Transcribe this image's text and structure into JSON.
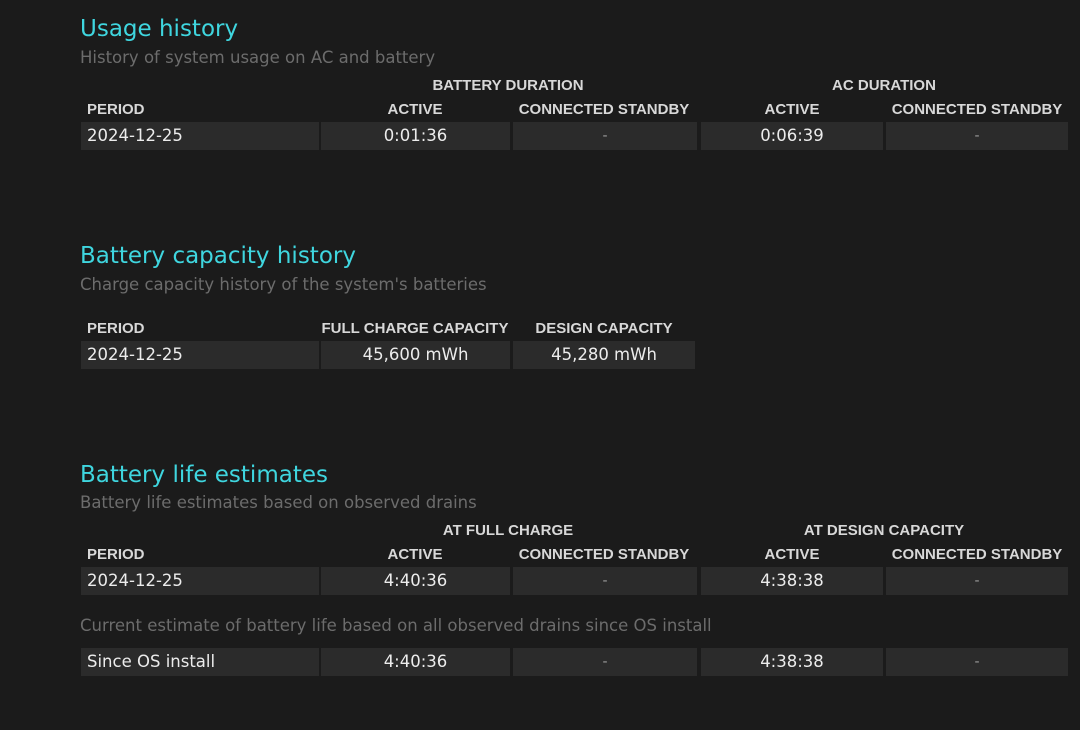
{
  "usage": {
    "title": "Usage history",
    "subtitle": "History of system usage on AC and battery",
    "group_battery": "BATTERY DURATION",
    "group_ac": "AC DURATION",
    "headers": [
      "PERIOD",
      "ACTIVE",
      "CONNECTED STANDBY",
      "ACTIVE",
      "CONNECTED STANDBY"
    ],
    "row": [
      "2024-12-25",
      "0:01:36",
      "-",
      "0:06:39",
      "-"
    ]
  },
  "capacity": {
    "title": "Battery capacity history",
    "subtitle": "Charge capacity history of the system's batteries",
    "headers": [
      "PERIOD",
      "FULL CHARGE CAPACITY",
      "DESIGN CAPACITY"
    ],
    "row": [
      "2024-12-25",
      "45,600 mWh",
      "45,280 mWh"
    ]
  },
  "estimates": {
    "title": "Battery life estimates",
    "subtitle": "Battery life estimates based on observed drains",
    "group_full": "AT FULL CHARGE",
    "group_design": "AT DESIGN CAPACITY",
    "headers": [
      "PERIOD",
      "ACTIVE",
      "CONNECTED STANDBY",
      "ACTIVE",
      "CONNECTED STANDBY"
    ],
    "row": [
      "2024-12-25",
      "4:40:36",
      "-",
      "4:38:38",
      "-"
    ],
    "os_note": "Current estimate of battery life based on all observed drains since OS install",
    "os_row": [
      "Since OS install",
      "4:40:36",
      "-",
      "4:38:38",
      "-"
    ]
  }
}
